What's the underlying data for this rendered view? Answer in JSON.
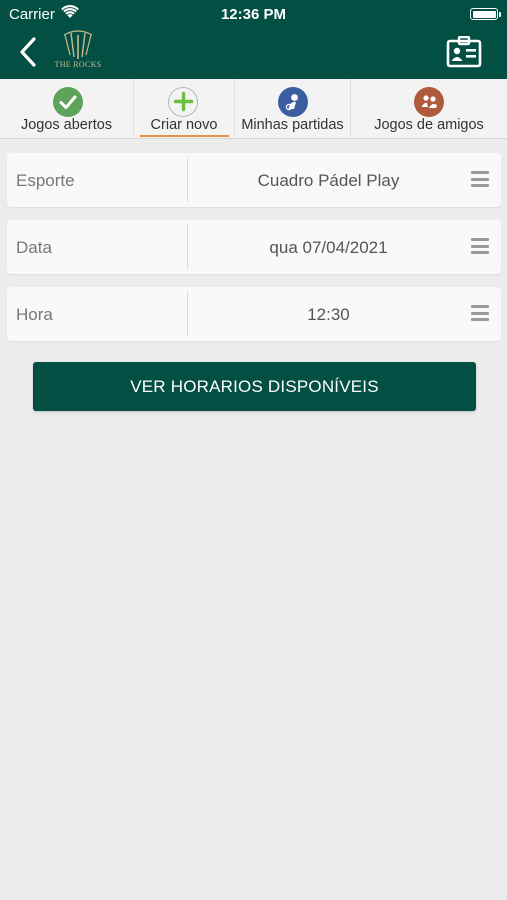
{
  "status_bar": {
    "carrier": "Carrier",
    "time": "12:36 PM"
  },
  "header": {
    "logo_text": "THE ROCKS",
    "background_color": "#034f44"
  },
  "tabs": [
    {
      "label": "Jogos abertos",
      "icon": "check-icon",
      "icon_color": "#5fa35a",
      "selected": false
    },
    {
      "label": "Criar novo",
      "icon": "plus-icon",
      "icon_color": "#6cbf3f",
      "selected": true
    },
    {
      "label": "Minhas partidas",
      "icon": "user-ball-icon",
      "icon_color": "#3b5ea1",
      "selected": false
    },
    {
      "label": "Jogos de amigos",
      "icon": "friends-icon",
      "icon_color": "#b05a3c",
      "selected": false
    }
  ],
  "form": {
    "sport": {
      "label": "Esporte",
      "value": "Cuadro Pádel Play"
    },
    "date": {
      "label": "Data",
      "value": "qua 07/04/2021"
    },
    "time": {
      "label": "Hora",
      "value": "12:30"
    }
  },
  "cta": {
    "label": "VER HORARIOS DISPONÍVEIS"
  },
  "accent_underline_color": "#e8913e"
}
